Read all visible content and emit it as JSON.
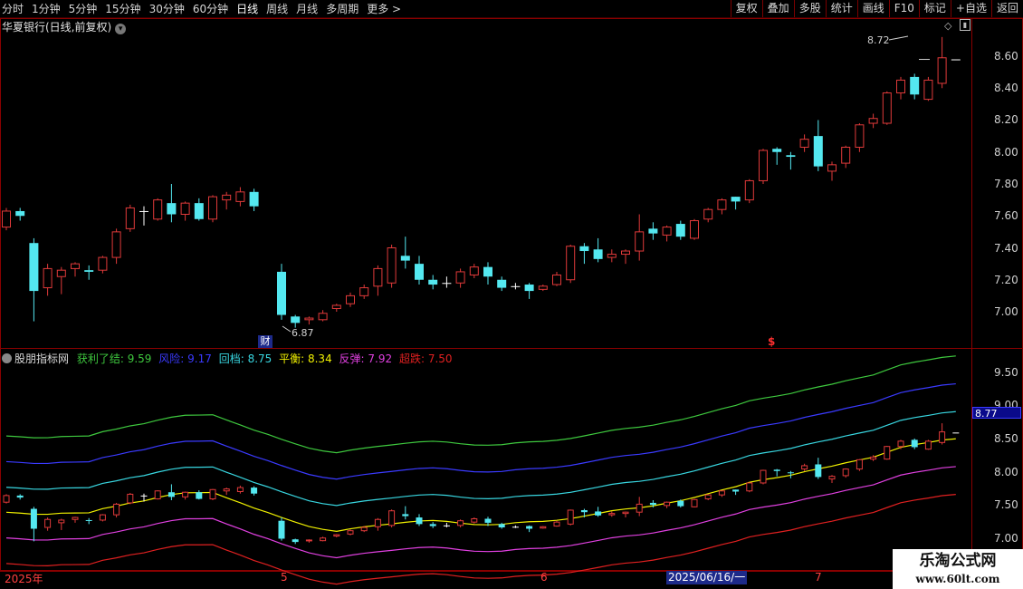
{
  "toolbar": {
    "periods": [
      "分时",
      "1分钟",
      "5分钟",
      "15分钟",
      "30分钟",
      "60分钟",
      "日线",
      "周线",
      "月线",
      "多周期",
      "更多 >"
    ],
    "active_period": "日线",
    "actions": [
      "复权",
      "叠加",
      "多股",
      "统计",
      "画线",
      "F10",
      "标记",
      "+自选",
      "返回"
    ]
  },
  "main_chart": {
    "title": "华夏银行(日线,前复权)",
    "high_marker": "8.72",
    "low_marker": "6.87",
    "finance_marker": "财",
    "signal_marker": "$",
    "y_ticks": [
      "8.60",
      "8.40",
      "8.20",
      "8.00",
      "7.80",
      "7.60",
      "7.40",
      "7.20",
      "7.00"
    ]
  },
  "indicator": {
    "name": "股朋指标网",
    "lines": [
      {
        "label": "获利了结",
        "value": "9.59",
        "color": "#3ec83e"
      },
      {
        "label": "风险",
        "value": "9.17",
        "color": "#3a3aff"
      },
      {
        "label": "回档",
        "value": "8.75",
        "color": "#38d6e0"
      },
      {
        "label": "平衡",
        "value": "8.34",
        "color": "#f0f000"
      },
      {
        "label": "反弹",
        "value": "7.92",
        "color": "#e040e0"
      },
      {
        "label": "超跌",
        "value": "7.50",
        "color": "#e02020"
      }
    ],
    "y_ticks": [
      "9.50",
      "9.00",
      "8.50",
      "8.00",
      "7.50",
      "7.00"
    ],
    "current_value": "8.77"
  },
  "x_axis": {
    "labels": [
      "2025年",
      "5",
      "6",
      "7"
    ],
    "cursor_date": "2025/06/16/一"
  },
  "watermark": {
    "line1": "乐淘公式网",
    "line2": "www.60lt.com"
  },
  "colors": {
    "up": "#e03a3a",
    "down": "#54e8f0",
    "cross": "#ffffff",
    "frame": "#8a0000"
  },
  "candles": [
    [
      7.53,
      7.63,
      7.51,
      7.65
    ],
    [
      7.63,
      7.6,
      7.57,
      7.65
    ],
    [
      7.43,
      7.13,
      6.94,
      7.46
    ],
    [
      7.15,
      7.27,
      7.1,
      7.3
    ],
    [
      7.22,
      7.26,
      7.11,
      7.28
    ],
    [
      7.27,
      7.3,
      7.22,
      7.31
    ],
    [
      7.26,
      7.25,
      7.2,
      7.29
    ],
    [
      7.26,
      7.34,
      7.24,
      7.35
    ],
    [
      7.34,
      7.5,
      7.3,
      7.52
    ],
    [
      7.52,
      7.65,
      7.5,
      7.67
    ],
    [
      7.63,
      7.63,
      7.54,
      7.66
    ],
    [
      7.58,
      7.7,
      7.57,
      7.71
    ],
    [
      7.68,
      7.61,
      7.56,
      7.8
    ],
    [
      7.61,
      7.68,
      7.57,
      7.69
    ],
    [
      7.68,
      7.58,
      7.57,
      7.71
    ],
    [
      7.58,
      7.72,
      7.56,
      7.73
    ],
    [
      7.7,
      7.73,
      7.64,
      7.75
    ],
    [
      7.69,
      7.75,
      7.66,
      7.78
    ],
    [
      7.75,
      7.66,
      7.63,
      7.77
    ],
    [
      null,
      null,
      null,
      null
    ],
    [
      7.25,
      6.98,
      6.95,
      7.3
    ],
    [
      6.97,
      6.93,
      6.9,
      6.98
    ],
    [
      6.95,
      6.96,
      6.92,
      6.97
    ],
    [
      6.95,
      6.99,
      6.94,
      7.01
    ],
    [
      7.02,
      7.04,
      7.0,
      7.05
    ],
    [
      7.05,
      7.1,
      7.03,
      7.12
    ],
    [
      7.1,
      7.15,
      7.08,
      7.17
    ],
    [
      7.16,
      7.27,
      7.1,
      7.29
    ],
    [
      7.18,
      7.4,
      7.15,
      7.42
    ],
    [
      7.35,
      7.32,
      7.27,
      7.47
    ],
    [
      7.3,
      7.2,
      7.17,
      7.35
    ],
    [
      7.2,
      7.17,
      7.14,
      7.23
    ],
    [
      7.18,
      7.18,
      7.15,
      7.22
    ],
    [
      7.18,
      7.25,
      7.15,
      7.27
    ],
    [
      7.23,
      7.28,
      7.21,
      7.3
    ],
    [
      7.28,
      7.22,
      7.17,
      7.31
    ],
    [
      7.2,
      7.15,
      7.13,
      7.22
    ],
    [
      7.16,
      7.16,
      7.14,
      7.18
    ],
    [
      7.17,
      7.13,
      7.08,
      7.18
    ],
    [
      7.14,
      7.16,
      7.13,
      7.17
    ],
    [
      7.17,
      7.23,
      7.16,
      7.25
    ],
    [
      7.2,
      7.41,
      7.18,
      7.42
    ],
    [
      7.41,
      7.38,
      7.3,
      7.43
    ],
    [
      7.39,
      7.33,
      7.31,
      7.46
    ],
    [
      7.34,
      7.36,
      7.31,
      7.39
    ],
    [
      7.36,
      7.38,
      7.3,
      7.39
    ],
    [
      7.38,
      7.5,
      7.32,
      7.61
    ],
    [
      7.52,
      7.49,
      7.45,
      7.56
    ],
    [
      7.48,
      7.53,
      7.44,
      7.54
    ],
    [
      7.55,
      7.47,
      7.45,
      7.57
    ],
    [
      7.46,
      7.57,
      7.45,
      7.58
    ],
    [
      7.58,
      7.64,
      7.56,
      7.65
    ],
    [
      7.64,
      7.7,
      7.61,
      7.71
    ],
    [
      7.72,
      7.69,
      7.64,
      7.72
    ],
    [
      7.7,
      7.82,
      7.68,
      7.83
    ],
    [
      7.82,
      8.01,
      7.8,
      8.02
    ],
    [
      8.02,
      8.0,
      7.92,
      8.03
    ],
    [
      7.98,
      7.97,
      7.89,
      8.0
    ],
    [
      8.03,
      8.08,
      8.0,
      8.11
    ],
    [
      8.1,
      7.91,
      7.88,
      8.2
    ],
    [
      7.88,
      7.92,
      7.82,
      7.94
    ],
    [
      7.93,
      8.03,
      7.9,
      8.04
    ],
    [
      8.03,
      8.17,
      8.0,
      8.18
    ],
    [
      8.18,
      8.21,
      8.15,
      8.24
    ],
    [
      8.18,
      8.37,
      8.17,
      8.38
    ],
    [
      8.37,
      8.45,
      8.33,
      8.47
    ],
    [
      8.47,
      8.36,
      8.33,
      8.49
    ],
    [
      8.33,
      8.45,
      8.32,
      8.47
    ],
    [
      8.43,
      8.59,
      8.4,
      8.72
    ],
    [
      8.58,
      8.58,
      8.58,
      8.58
    ]
  ]
}
